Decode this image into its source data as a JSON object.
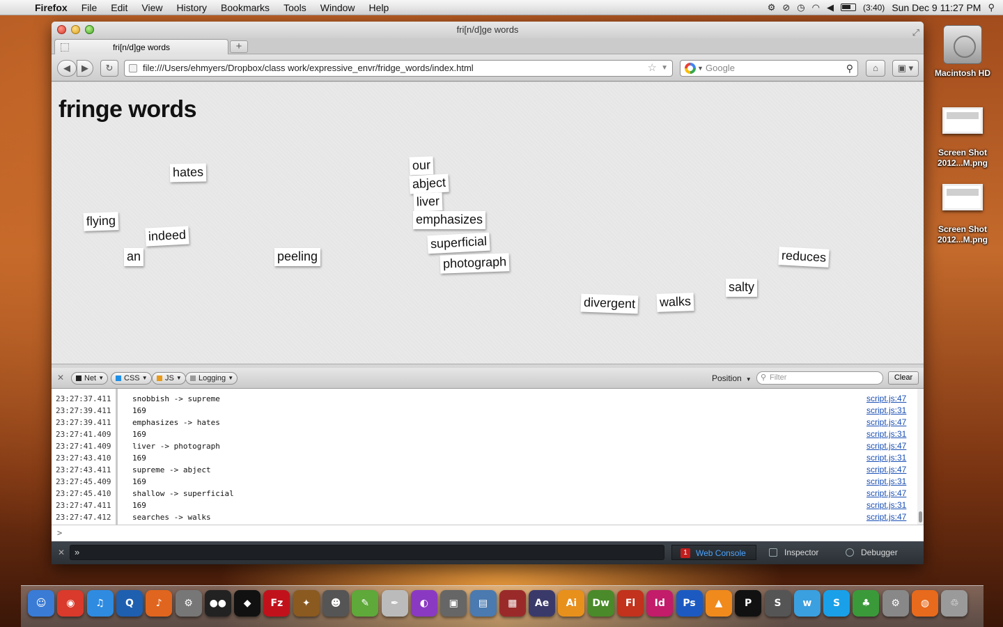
{
  "menubar": {
    "app_name": "Firefox",
    "items": [
      "File",
      "Edit",
      "View",
      "History",
      "Bookmarks",
      "Tools",
      "Window",
      "Help"
    ],
    "battery": "(3:40)",
    "datetime": "Sun Dec 9  11:27 PM"
  },
  "window": {
    "title": "fri[n/d]ge words",
    "tab_label": "fri[n/d]ge words",
    "new_tab": "+",
    "url": "file:///Users/ehmyers/Dropbox/class work/expressive_envr/fridge_words/index.html",
    "search_placeholder": "Google"
  },
  "page": {
    "title": "fringe words",
    "words": [
      "hates",
      "flying",
      "indeed",
      "an",
      "peeling",
      "our",
      "abject",
      "liver",
      "emphasizes",
      "superficial",
      "photograph",
      "divergent",
      "walks",
      "salty",
      "reduces"
    ]
  },
  "console": {
    "filters": [
      "Net",
      "CSS",
      "JS",
      "Logging"
    ],
    "filter_colors": [
      "#222222",
      "#1f8ee6",
      "#e89a1a",
      "#999999"
    ],
    "position_label": "Position",
    "filter_placeholder": "Filter",
    "clear_label": "Clear",
    "prompt": ">",
    "rows": [
      {
        "ts": "23:27:37.411",
        "msg": "snobbish -> supreme",
        "src": "script.js:47"
      },
      {
        "ts": "23:27:39.411",
        "msg": "169",
        "src": "script.js:31"
      },
      {
        "ts": "23:27:39.411",
        "msg": "emphasizes -> hates",
        "src": "script.js:47"
      },
      {
        "ts": "23:27:41.409",
        "msg": "169",
        "src": "script.js:31"
      },
      {
        "ts": "23:27:41.409",
        "msg": "liver -> photograph",
        "src": "script.js:47"
      },
      {
        "ts": "23:27:43.410",
        "msg": "169",
        "src": "script.js:31"
      },
      {
        "ts": "23:27:43.411",
        "msg": "supreme -> abject",
        "src": "script.js:47"
      },
      {
        "ts": "23:27:45.409",
        "msg": "169",
        "src": "script.js:31"
      },
      {
        "ts": "23:27:45.410",
        "msg": "shallow -> superficial",
        "src": "script.js:47"
      },
      {
        "ts": "23:27:47.411",
        "msg": "169",
        "src": "script.js:31"
      },
      {
        "ts": "23:27:47.412",
        "msg": "searches -> walks",
        "src": "script.js:47"
      }
    ]
  },
  "devtools": {
    "cmd_prompt": "»",
    "tabs": [
      {
        "label": "Web Console",
        "badge": "1"
      },
      {
        "label": "Inspector"
      },
      {
        "label": "Debugger"
      }
    ]
  },
  "desktop": {
    "icons": [
      "Macintosh HD",
      "Screen Shot 2012...M.png",
      "Screen Shot 2012...M.png"
    ]
  },
  "dock": {
    "items": [
      {
        "icon": "finder-icon",
        "glyph": "☺",
        "color": "#3a7bd5"
      },
      {
        "icon": "chrome-icon",
        "glyph": "◉",
        "color": "#d93a2b"
      },
      {
        "icon": "itunes-icon",
        "glyph": "♫",
        "color": "#2f8be0"
      },
      {
        "icon": "quicktime-icon",
        "glyph": "Q",
        "color": "#1e5fb0"
      },
      {
        "icon": "audacity-icon",
        "glyph": "♪",
        "color": "#e0651e"
      },
      {
        "icon": "automator-icon",
        "glyph": "⚙",
        "color": "#777777"
      },
      {
        "icon": "eyes-icon",
        "glyph": "●●",
        "color": "#222222"
      },
      {
        "icon": "cyberduck-icon",
        "glyph": "◆",
        "color": "#111111"
      },
      {
        "icon": "filezilla-icon",
        "glyph": "Fz",
        "color": "#c1121c"
      },
      {
        "icon": "fetch-icon",
        "glyph": "✦",
        "color": "#8a5a20"
      },
      {
        "icon": "github-icon",
        "glyph": "☻",
        "color": "#555555"
      },
      {
        "icon": "evernote-icon",
        "glyph": "✎",
        "color": "#5fa83a"
      },
      {
        "icon": "textedit-icon",
        "glyph": "✒",
        "color": "#bbbbbb"
      },
      {
        "icon": "colorsync-icon",
        "glyph": "◐",
        "color": "#8a3ac2"
      },
      {
        "icon": "screenshot-icon",
        "glyph": "▣",
        "color": "#666666"
      },
      {
        "icon": "preview-icon",
        "glyph": "▤",
        "color": "#4a7ab0"
      },
      {
        "icon": "pdf-icon",
        "glyph": "▦",
        "color": "#9a2a2a"
      },
      {
        "icon": "after-effects-icon",
        "glyph": "Ae",
        "color": "#3a3a6a"
      },
      {
        "icon": "illustrator-icon",
        "glyph": "Ai",
        "color": "#e8901c"
      },
      {
        "icon": "dreamweaver-icon",
        "glyph": "Dw",
        "color": "#4a8a2a"
      },
      {
        "icon": "flash-icon",
        "glyph": "Fl",
        "color": "#c2321c"
      },
      {
        "icon": "indesign-icon",
        "glyph": "Id",
        "color": "#c21c6a"
      },
      {
        "icon": "photoshop-icon",
        "glyph": "Ps",
        "color": "#1c5ac2"
      },
      {
        "icon": "vlc-icon",
        "glyph": "▲",
        "color": "#f08a1c"
      },
      {
        "icon": "p-app-icon",
        "glyph": "P",
        "color": "#111111"
      },
      {
        "icon": "sublime-icon",
        "glyph": "S",
        "color": "#555555"
      },
      {
        "icon": "wacom-icon",
        "glyph": "w",
        "color": "#3aa0e0"
      },
      {
        "icon": "skype-icon",
        "glyph": "S",
        "color": "#1aa0e8"
      },
      {
        "icon": "adium-icon",
        "glyph": "♣",
        "color": "#3a9a3a"
      },
      {
        "icon": "system-preferences-icon",
        "glyph": "⚙",
        "color": "#888888"
      },
      {
        "icon": "firefox-icon",
        "glyph": "◍",
        "color": "#e86a1c"
      },
      {
        "icon": "trash-icon",
        "glyph": "♲",
        "color": "#9a9a9a"
      }
    ]
  }
}
